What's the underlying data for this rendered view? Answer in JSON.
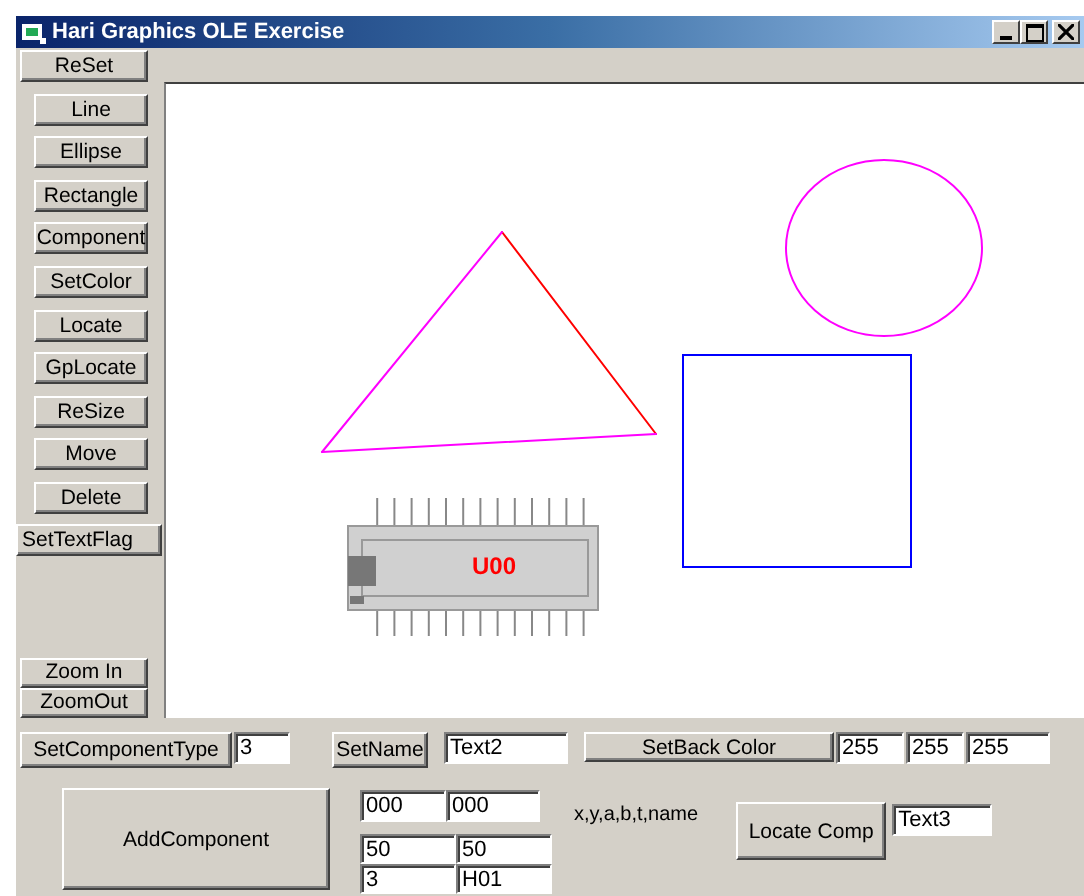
{
  "window": {
    "title": "Hari Graphics OLE Exercise"
  },
  "reset_button": "ReSet",
  "tool_buttons": [
    "Line",
    "Ellipse",
    "Rectangle",
    "Component",
    "SetColor",
    "Locate",
    "GpLocate",
    "ReSize",
    "Move",
    "Delete"
  ],
  "text_flag_button": "SetTextFlag",
  "zoom_buttons": [
    "Zoom In",
    "ZoomOut"
  ],
  "canvas": {
    "shapes": [
      {
        "kind": "triangle",
        "edges": [
          {
            "color": "#ff0000"
          },
          {
            "color": "#ff00ff"
          },
          {
            "color": "#ff00ff"
          }
        ]
      },
      {
        "kind": "ellipse",
        "color": "#ff00ff"
      },
      {
        "kind": "rectangle",
        "color": "#0000ff"
      },
      {
        "kind": "chip",
        "label": "U00",
        "color": "#ff0000"
      }
    ]
  },
  "set_component_type": {
    "button": "SetComponentType",
    "value": "3"
  },
  "set_name": {
    "button": "SetName",
    "value": "Text2"
  },
  "set_back_color": {
    "button": "SetBack Color",
    "values": [
      "255",
      "255",
      "255"
    ]
  },
  "add_component": {
    "button": "AddComponent",
    "fields": [
      "000",
      "000",
      "50",
      "50",
      "3",
      "H01"
    ],
    "hint": "x,y,a,b,t,name"
  },
  "locate_comp": {
    "button": "Locate Comp",
    "value": "Text3"
  }
}
